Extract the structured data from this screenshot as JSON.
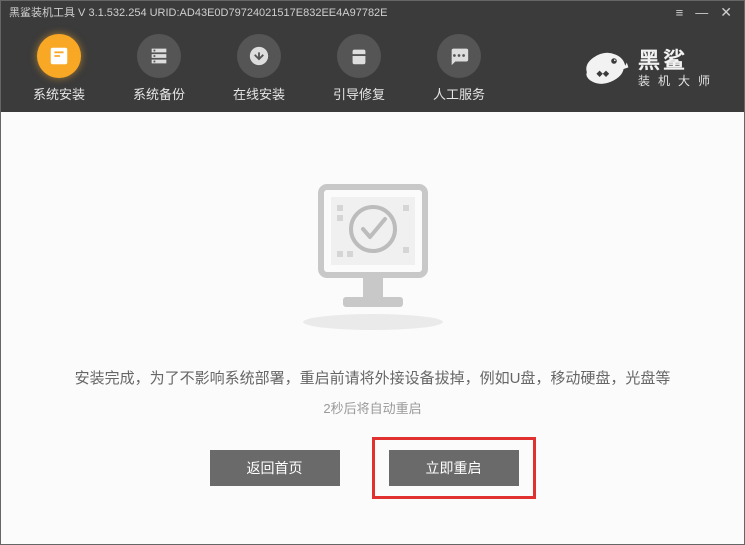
{
  "titlebar": {
    "text": "黑鲨装机工具 V 3.1.532.254 URID:AD43E0D79724021517E832EE4A97782E"
  },
  "nav": {
    "items": [
      {
        "label": "系统安装",
        "icon": "install-icon",
        "active": true
      },
      {
        "label": "系统备份",
        "icon": "backup-icon",
        "active": false
      },
      {
        "label": "在线安装",
        "icon": "download-icon",
        "active": false
      },
      {
        "label": "引导修复",
        "icon": "repair-icon",
        "active": false
      },
      {
        "label": "人工服务",
        "icon": "chat-icon",
        "active": false
      }
    ]
  },
  "brand": {
    "main": "黑鲨",
    "sub": "装机大师"
  },
  "content": {
    "message": "安装完成，为了不影响系统部署，重启前请将外接设备拔掉，例如U盘，移动硬盘，光盘等",
    "countdown": "2秒后将自动重启",
    "back_label": "返回首页",
    "restart_label": "立即重启"
  }
}
